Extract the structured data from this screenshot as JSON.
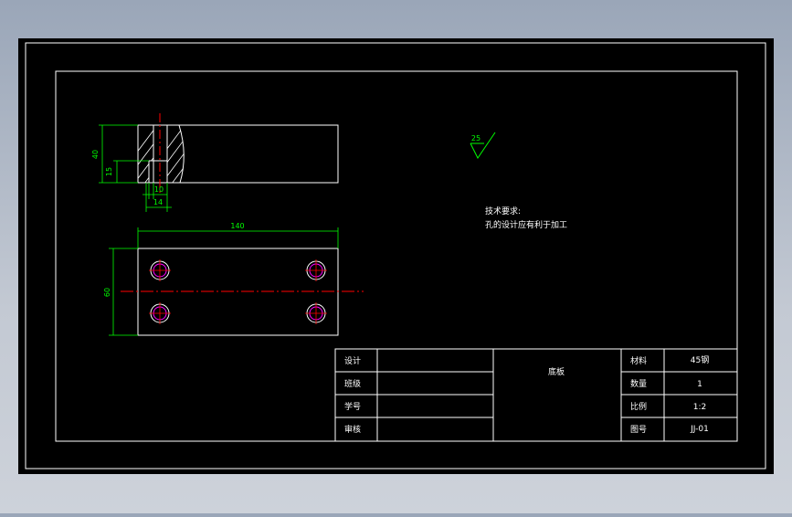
{
  "drawing": {
    "dimensions": {
      "dim_40": "40",
      "dim_15": "15",
      "dim_10": "10",
      "dim_14": "14",
      "dim_140": "140",
      "dim_60": "60"
    },
    "roughness": "25",
    "tech_req": {
      "title": "技术要求:",
      "line1": "孔的设计应有利于加工"
    }
  },
  "title_block": {
    "design_label": "设计",
    "class_label": "班级",
    "student_id_label": "学号",
    "review_label": "审核",
    "part_name": "底板",
    "material_label": "材料",
    "material_value": "45钢",
    "quantity_label": "数量",
    "quantity_value": "1",
    "scale_label": "比例",
    "scale_value": "1:2",
    "drawing_no_label": "图号",
    "drawing_no_value": "JJ-01"
  },
  "colors": {
    "background": "#000000",
    "line": "#ffffff",
    "dimension": "#00ff00",
    "centerline": "#ff0000",
    "hole": "#ff00ff"
  }
}
